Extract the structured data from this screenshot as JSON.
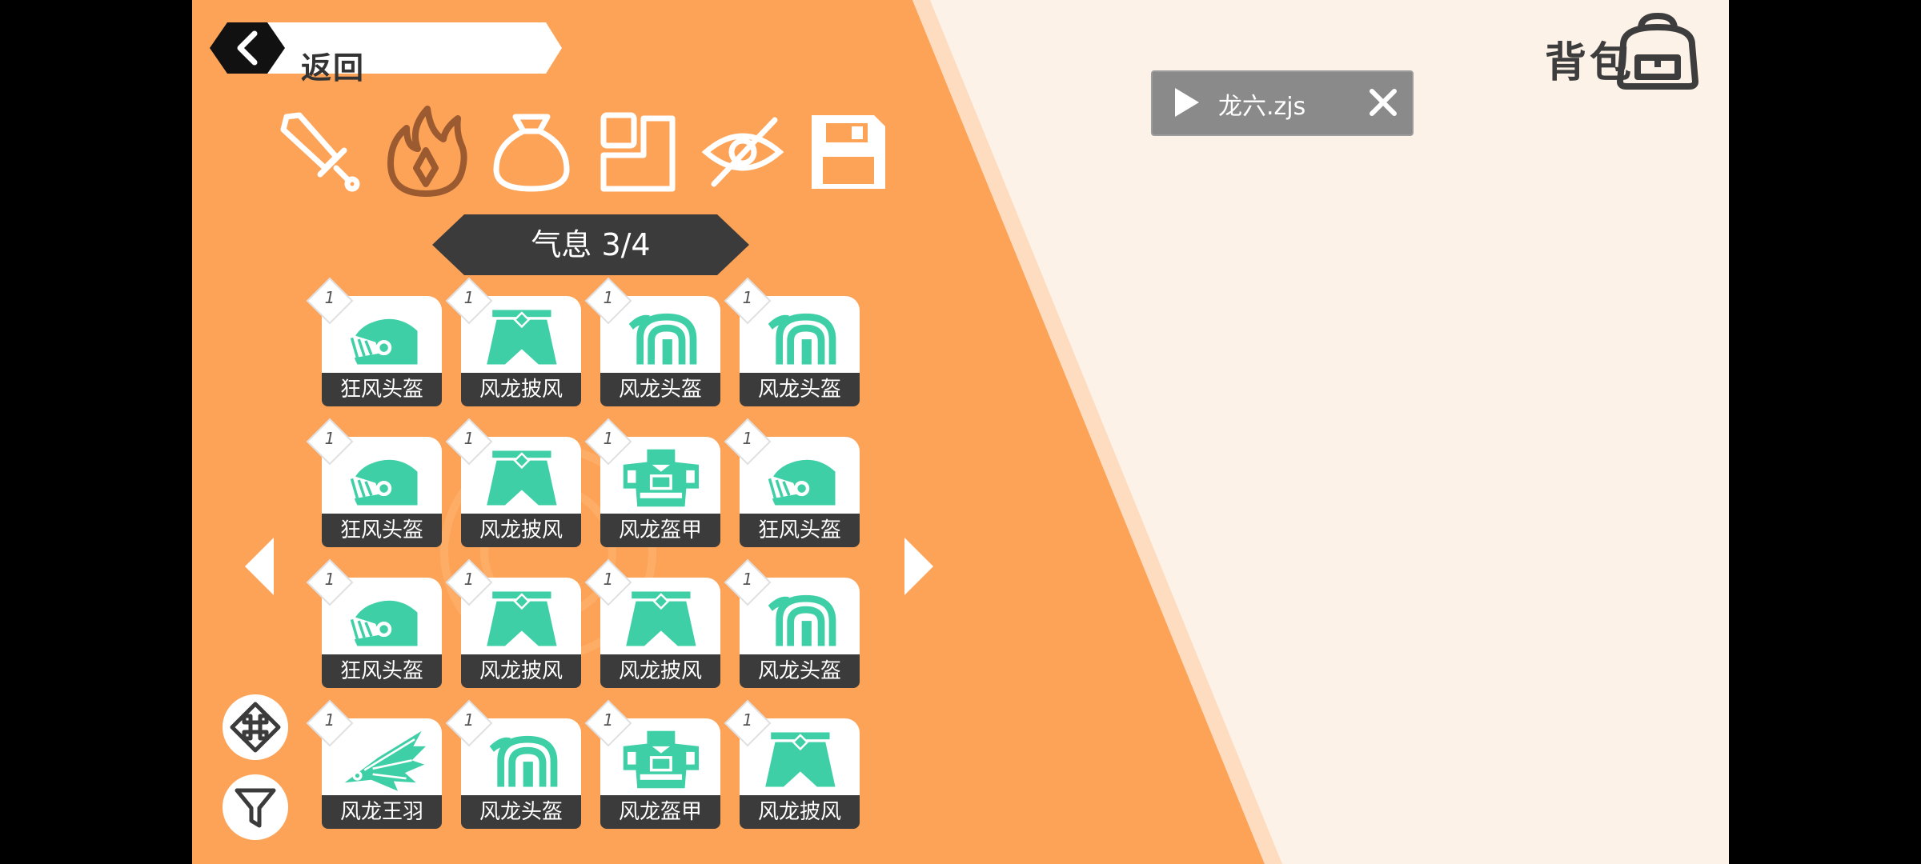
{
  "header": {
    "back_label": "返回",
    "bag_label": "背包",
    "back_icon": "chevron-left-icon",
    "bag_icon": "backpack-icon"
  },
  "tabs": [
    {
      "name": "sword-icon",
      "active": false
    },
    {
      "name": "fire-icon",
      "active": true
    },
    {
      "name": "pouch-icon",
      "active": false
    },
    {
      "name": "corner-square-icon",
      "active": false
    },
    {
      "name": "eye-slash-icon",
      "active": false
    },
    {
      "name": "save-icon",
      "active": false
    }
  ],
  "category": {
    "title": "气息 3/4"
  },
  "items": [
    {
      "name": "狂风头盔",
      "count": "1",
      "icon": "visor-helmet"
    },
    {
      "name": "风龙披风",
      "count": "1",
      "icon": "cape"
    },
    {
      "name": "风龙头盔",
      "count": "1",
      "icon": "crest-helmet"
    },
    {
      "name": "风龙头盔",
      "count": "1",
      "icon": "crest-helmet"
    },
    {
      "name": "狂风头盔",
      "count": "1",
      "icon": "visor-helmet"
    },
    {
      "name": "风龙披风",
      "count": "1",
      "icon": "cape"
    },
    {
      "name": "风龙盔甲",
      "count": "1",
      "icon": "armor"
    },
    {
      "name": "狂风头盔",
      "count": "1",
      "icon": "visor-helmet"
    },
    {
      "name": "狂风头盔",
      "count": "1",
      "icon": "visor-helmet"
    },
    {
      "name": "风龙披风",
      "count": "1",
      "icon": "cape"
    },
    {
      "name": "风龙披风",
      "count": "1",
      "icon": "cape"
    },
    {
      "name": "风龙头盔",
      "count": "1",
      "icon": "crest-helmet"
    },
    {
      "name": "风龙王羽",
      "count": "1",
      "icon": "feather"
    },
    {
      "name": "风龙头盔",
      "count": "1",
      "icon": "crest-helmet"
    },
    {
      "name": "风龙盔甲",
      "count": "1",
      "icon": "armor"
    },
    {
      "name": "风龙披风",
      "count": "1",
      "icon": "cape"
    }
  ],
  "popup": {
    "file_name": "龙六.zjs",
    "play_icon": "play-icon",
    "close_icon": "close-icon"
  },
  "colors": {
    "orange": "#fda358",
    "cream": "#fdf2e8",
    "teal": "#3ecfa6",
    "dark": "#3b3b3b",
    "active_tab": "#9b5a30"
  }
}
